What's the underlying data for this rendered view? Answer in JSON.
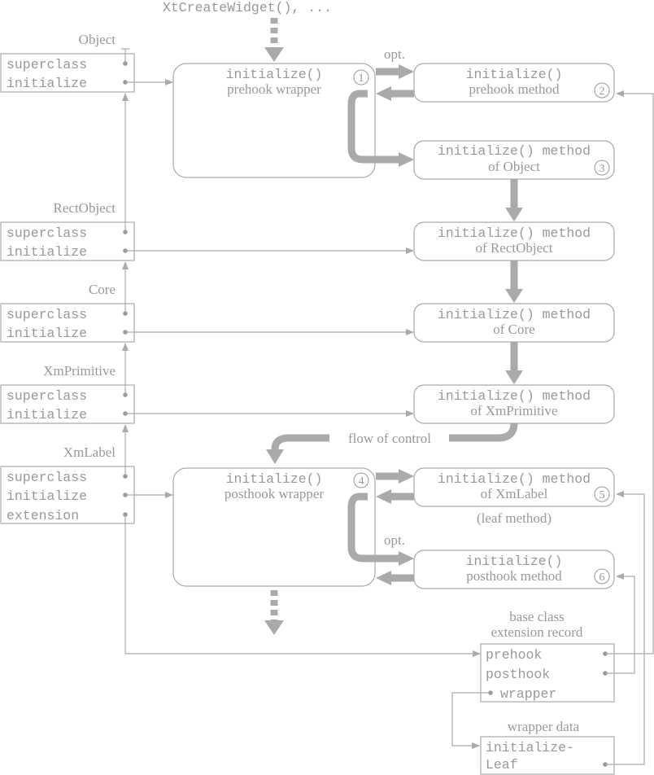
{
  "diagram": {
    "entry_label": "XtCreateWidget(), ...",
    "classes": [
      {
        "name": "Object",
        "fields": [
          "superclass",
          "initialize"
        ]
      },
      {
        "name": "RectObject",
        "fields": [
          "superclass",
          "initialize"
        ]
      },
      {
        "name": "Core",
        "fields": [
          "superclass",
          "initialize"
        ]
      },
      {
        "name": "XmPrimitive",
        "fields": [
          "superclass",
          "initialize"
        ]
      },
      {
        "name": "XmLabel",
        "fields": [
          "superclass",
          "initialize",
          "extension"
        ]
      }
    ],
    "prehook_wrapper": {
      "line1": "initialize()",
      "line2": "prehook wrapper",
      "step": "1"
    },
    "prehook_method": {
      "line1": "initialize()",
      "line2": "prehook method",
      "step": "2"
    },
    "object_method": {
      "line1": "initialize() method",
      "line2": "of Object",
      "step": "3"
    },
    "rectobject_method": {
      "line1": "initialize() method",
      "line2": "of RectObject"
    },
    "core_method": {
      "line1": "initialize() method",
      "line2": "of Core"
    },
    "xmprimitive_method": {
      "line1": "initialize() method",
      "line2": "of XmPrimitive"
    },
    "posthook_wrapper": {
      "line1": "initialize()",
      "line2": "posthook wrapper",
      "step": "4"
    },
    "xmlabel_method": {
      "line1": "initialize() method",
      "line2": "of XmLabel",
      "step": "5"
    },
    "leaf_note": "(leaf method)",
    "posthook_method": {
      "line1": "initialize()",
      "line2": "posthook method",
      "step": "6"
    },
    "opt_label_1": "opt.",
    "opt_label_2": "opt.",
    "flow_label": "flow of control",
    "ext_record": {
      "title1": "base class",
      "title2": "extension record",
      "fields": [
        "prehook",
        "posthook",
        "wrapper"
      ]
    },
    "wrapper_data": {
      "title": "wrapper data",
      "fields": [
        "initialize-",
        "Leaf"
      ]
    },
    "colors": {
      "stroke": "#aaaaaa",
      "text": "#999999",
      "background": "#ffffff"
    }
  }
}
